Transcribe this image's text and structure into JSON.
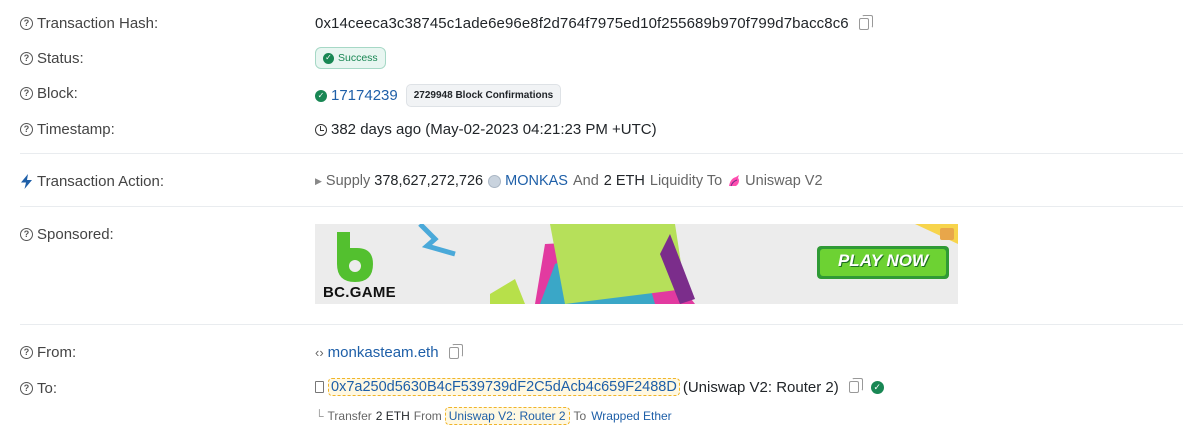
{
  "transaction_hash": {
    "label": "Transaction Hash:",
    "value": "0x14ceeca3c38745c1ade6e96e8f2d764f7975ed10f255689b970f799d7bacc8c6"
  },
  "status": {
    "label": "Status:",
    "value": "Success"
  },
  "block": {
    "label": "Block:",
    "number": "17174239",
    "confirmations": "2729948 Block Confirmations"
  },
  "timestamp": {
    "label": "Timestamp:",
    "value": "382 days ago (May-02-2023 04:21:23 PM +UTC)"
  },
  "transaction_action": {
    "label": "Transaction Action:",
    "verb": "Supply",
    "amount": "378,627,272,726",
    "token": "MONKAS",
    "and_text": "And",
    "eth_amount": "2 ETH",
    "liquidity_text": "Liquidity To",
    "protocol": "Uniswap V2"
  },
  "sponsored": {
    "label": "Sponsored:",
    "brand": "BC.GAME",
    "cta": "PLAY NOW"
  },
  "from": {
    "label": "From:",
    "value": "monkasteam.eth"
  },
  "to": {
    "label": "To:",
    "address": "0x7a250d5630B4cF539739dF2C5dAcb4c659F2488D",
    "name": "(Uniswap V2: Router 2)",
    "transfer_prefix": "Transfer",
    "transfer_amount": "2 ETH",
    "transfer_from_label": "From",
    "transfer_from": "Uniswap V2: Router 2",
    "transfer_to_label": "To",
    "transfer_to": "Wrapped Ether"
  },
  "colors": {
    "accent_link": "#1e5fa8",
    "success_green": "#198754",
    "highlight_border": "#f0b429"
  }
}
